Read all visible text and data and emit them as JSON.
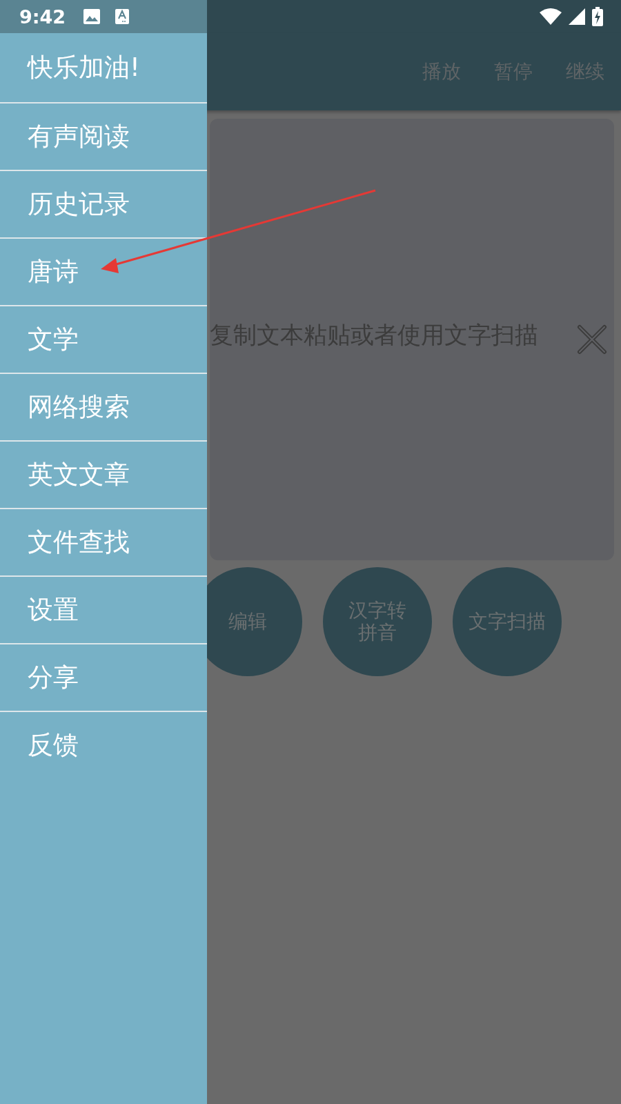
{
  "status_bar": {
    "time": "9:42"
  },
  "app_bar": {
    "actions": [
      "播放",
      "暂停",
      "继续"
    ]
  },
  "text_card": {
    "placeholder": "复制文本粘贴或者使用文字扫描"
  },
  "round_buttons": [
    {
      "lines": [
        "编辑"
      ]
    },
    {
      "lines": [
        "汉字转",
        "拼音"
      ]
    },
    {
      "lines": [
        "文字扫描"
      ]
    }
  ],
  "drawer": {
    "header": "快乐加油!",
    "items": [
      "有声阅读",
      "历史记录",
      "唐诗",
      "文学",
      "网络搜索",
      "英文文章",
      "文件查找",
      "设置",
      "分享",
      "反馈"
    ]
  }
}
